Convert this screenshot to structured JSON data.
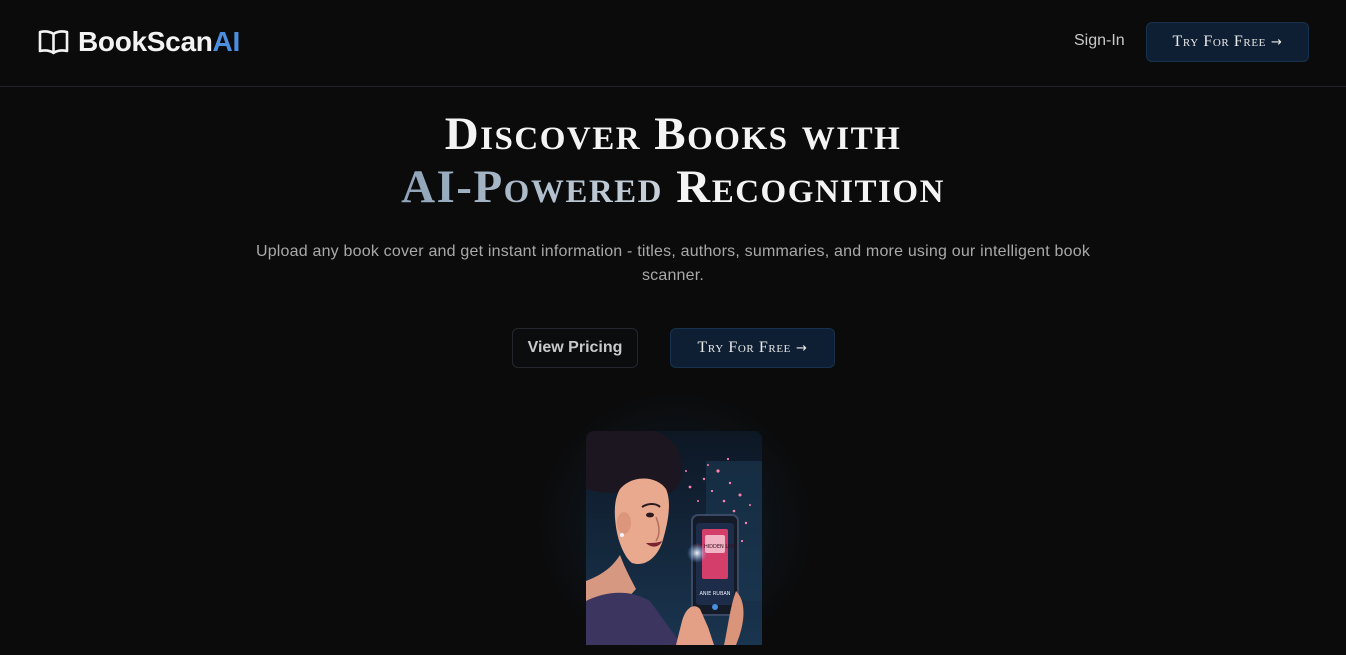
{
  "header": {
    "brand_main": "BookScan",
    "brand_accent": "AI",
    "signin_label": "Sign-In",
    "try_label": "Try For Free",
    "try_arrow": "→"
  },
  "hero": {
    "title_line1": "Discover Books with",
    "title_line2_highlight": "AI-Powered",
    "title_line2_rest": " Recognition",
    "subtitle": "Upload any book cover and get instant information - titles, authors, summaries, and more using our intelligent book scanner.",
    "pricing_label": "View Pricing",
    "try_label": "Try For Free",
    "try_arrow": "→"
  },
  "illustration": {
    "book_title": "THE HIDDEN LEAF",
    "book_author": "ANIE RUBAN"
  },
  "colors": {
    "background": "#0b0b0c",
    "accent": "#4a8fe0",
    "button_bg": "#0f1f33"
  },
  "icons": {
    "brand": "open-book-icon",
    "arrow": "arrow-right-icon"
  }
}
